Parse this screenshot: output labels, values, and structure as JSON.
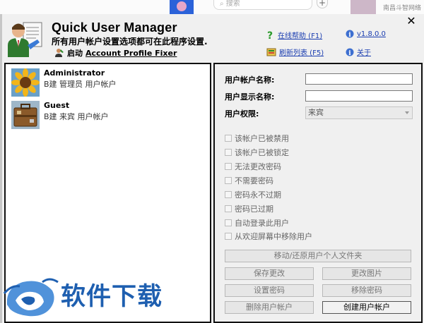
{
  "background": {
    "search_placeholder": "搜索",
    "plus_label": "+",
    "right_text": "南昌斗智网络"
  },
  "app": {
    "title": "Quick User Manager",
    "description": "所有用户帐户设置选项都可在此程序设置.",
    "apf_label": "启动",
    "apf_link": "Account Profile Fixer",
    "close_glyph": "✕",
    "links": {
      "help": "在线帮助 (F1)",
      "refresh": "刷新列表 (F5)",
      "version": "v1.8.0.0",
      "about": "关于"
    }
  },
  "users": [
    {
      "name": "Administrator",
      "desc": "B建 管理员 用户帐户",
      "icon": "sunflower-icon"
    },
    {
      "name": "Guest",
      "desc": "B建 来宾 用户帐户",
      "icon": "suitcase-icon"
    }
  ],
  "form": {
    "account_name_label": "用户帐户名称:",
    "display_name_label": "用户显示名称:",
    "permission_label": "用户权限:",
    "permission_value": "来宾",
    "account_name_value": "",
    "display_name_value": ""
  },
  "options": [
    "该帐户已被禁用",
    "该帐户已被锁定",
    "无法更改密码",
    "不需要密码",
    "密码永不过期",
    "密码已过期",
    "自动登录此用户",
    "从欢迎屏幕中移除用户"
  ],
  "buttons": {
    "move_profile": "移动/还原用户个人文件夹",
    "save": "保存更改",
    "change_picture": "更改图片",
    "set_password": "设置密码",
    "remove_password": "移除密码",
    "delete_account": "删除用户帐户",
    "create_account": "创建用户帐户"
  },
  "watermark": {
    "text": "软件下载"
  },
  "colors": {
    "link": "#1a3db0",
    "watermark": "#1e5fb0"
  }
}
